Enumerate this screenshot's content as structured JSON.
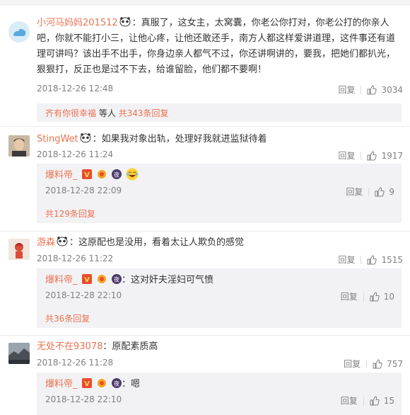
{
  "comments": [
    {
      "user": "小河马妈妈201512",
      "text": "：真服了，这女主，太窝囊，你老公你打对，你老公打的你亲人吧，你就不能打小三，让他心疼，让他还敢还手，南方人都这样爱讲道理，这件事还有道理可讲吗？该出手不出手，你身边亲人都气不过，你还讲啊讲的，要我，把她们都扒光，狠狠打，反正也是过不下去，给谁留脸，他们都不要啊！",
      "time": "2018-12-26 12:48",
      "reply_label": "回复",
      "likes": "3034",
      "summary": {
        "user": "齐有你很幸福",
        "middle": " 等人 ",
        "link": "共343条回复"
      }
    },
    {
      "user": "StingWet",
      "text": "：如果我对象出轨，处理好我就进监狱待着",
      "time": "2018-12-26 11:24",
      "reply_label": "回复",
      "likes": "1917",
      "sub": {
        "user": "爆料帝_",
        "text": "",
        "time": "2018-12-28 22:09",
        "reply_label": "回复",
        "likes": "9"
      },
      "more": "共129条回复"
    },
    {
      "user": "游森",
      "text": "：这原配也是没用，看着太让人欺负的感觉",
      "time": "2018-12-26 11:22",
      "reply_label": "回复",
      "likes": "1515",
      "sub": {
        "user": "爆料帝_",
        "text": "：这对奸夫淫妇可气愤",
        "time": "2018-12-28 22:10",
        "reply_label": "回复",
        "likes": "10"
      },
      "more": "共36条回复"
    },
    {
      "user": "无处不在93078",
      "text": "：原配素质高",
      "time": "2018-12-26 11:28",
      "reply_label": "回复",
      "likes": "757",
      "sub": {
        "user": "爆料帝_",
        "text": "：嗯",
        "time": "2018-12-28 22:10",
        "reply_label": "回复",
        "likes": "15"
      }
    }
  ],
  "colors": {
    "accent": "#eb7350",
    "muted": "#808080",
    "subbg": "#f2f2f5"
  }
}
